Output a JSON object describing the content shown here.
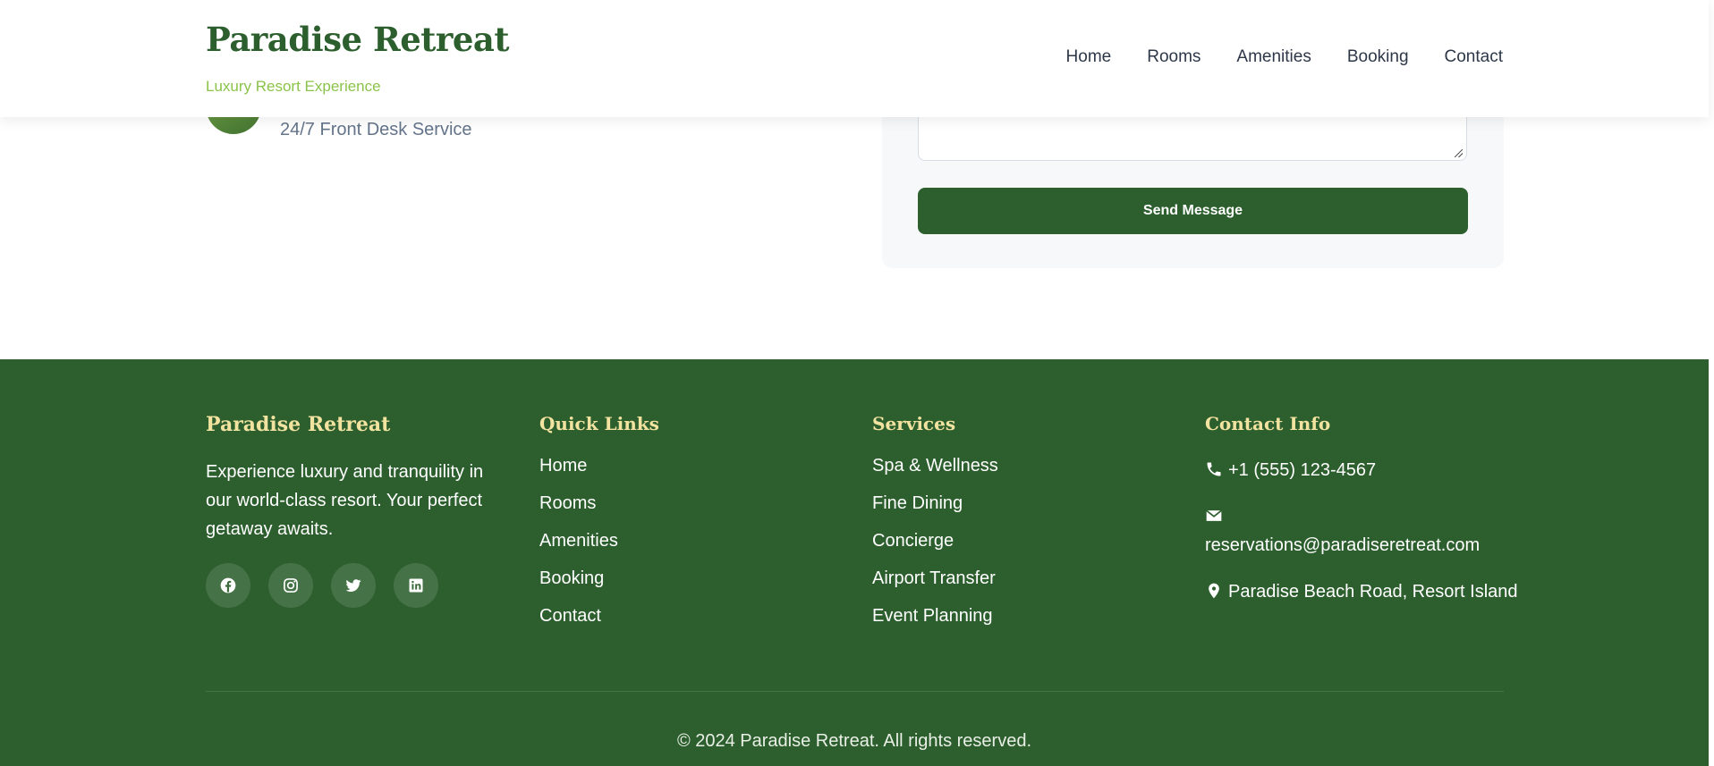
{
  "header": {
    "brand_title": "Paradise Retreat",
    "brand_tagline": "Luxury Resort Experience",
    "nav": [
      "Home",
      "Rooms",
      "Amenities",
      "Booking",
      "Contact"
    ]
  },
  "contact_section": {
    "front_desk_text": "24/7 Front Desk Service",
    "message_value": "",
    "send_button_label": "Send Message"
  },
  "footer": {
    "about": {
      "title": "Paradise Retreat",
      "description": "Experience luxury and tranquility in our world-class resort. Your perfect getaway awaits.",
      "socials": [
        "facebook-icon",
        "instagram-icon",
        "twitter-icon",
        "linkedin-icon"
      ]
    },
    "quick_links": {
      "title": "Quick Links",
      "items": [
        "Home",
        "Rooms",
        "Amenities",
        "Booking",
        "Contact"
      ]
    },
    "services": {
      "title": "Services",
      "items": [
        "Spa & Wellness",
        "Fine Dining",
        "Concierge",
        "Airport Transfer",
        "Event Planning"
      ]
    },
    "contact_info": {
      "title": "Contact Info",
      "phone": "+1 (555) 123-4567",
      "email": "reservations@paradiseretreat.com",
      "address": "Paradise Beach Road, Resort Island"
    },
    "copyright": "© 2024 Paradise Retreat. All rights reserved."
  },
  "colors": {
    "brand_green": "#2d5f2e",
    "accent_lightgreen": "#8bc34a",
    "footer_heading": "#f3e3a0"
  }
}
